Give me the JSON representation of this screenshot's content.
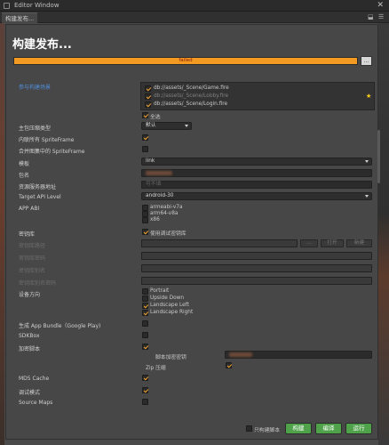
{
  "window": {
    "title": "Editor Window",
    "close": "✕"
  },
  "tab": {
    "label": "构建发布...",
    "ctl1": "⬓",
    "ctl2": "☰"
  },
  "header": {
    "title": "构建发布..."
  },
  "progress": {
    "status": "failed",
    "fraction": 1.0,
    "button": "…"
  },
  "scenes_section": {
    "label": "参与构建场景",
    "items": [
      {
        "path": "db://assets/_Scene/Game.fire",
        "checked": true,
        "disabled": false
      },
      {
        "path": "db://assets/_Scene/Lobby.fire",
        "checked": true,
        "disabled": true
      },
      {
        "path": "db://assets/_Scene/Login.fire",
        "checked": true,
        "disabled": false
      }
    ],
    "select_all": "全选"
  },
  "fields": {
    "main_compress": {
      "label": "主包压缩类型",
      "value": "默认"
    },
    "inline_spriteframe": {
      "label": "内联所有 SpriteFrame"
    },
    "merge_spriteframe": {
      "label": "合并图集中的 SpriteFrame"
    },
    "template": {
      "label": "模板",
      "value": "link"
    },
    "package_name": {
      "label": "包名"
    },
    "resource_server": {
      "label": "资源服务器地址",
      "placeholder": "可不填"
    },
    "target_api": {
      "label": "Target API Level",
      "value": "android-30"
    },
    "app_abi": {
      "label": "APP ABI",
      "options": [
        "armeabi-v7a",
        "arm64-v8a",
        "x86"
      ]
    },
    "keystore": {
      "label": "密钥库",
      "option": "使用调试密钥库"
    },
    "keystore_path": {
      "label": "密钥库路径",
      "btn_dots": "…",
      "btn_open": "打开",
      "btn_new": "新建"
    },
    "keystore_pwd": {
      "label": "密钥库密码"
    },
    "key_alias": {
      "label": "密钥库别名"
    },
    "key_pwd": {
      "label": "密钥库别名密码"
    },
    "orientation": {
      "label": "设备方向",
      "options": [
        "Portrait",
        "Upside Down",
        "Landscape Left",
        "Landscape Right"
      ]
    },
    "app_bundle": {
      "label": "生成 App Bundle（Google Play)"
    },
    "sdkbox": {
      "label": "SDKBox"
    },
    "encrypt": {
      "label": "加密脚本",
      "key_label": "脚本加密密钥",
      "zip_label": "Zip 压缩"
    },
    "md5": {
      "label": "MD5 Cache"
    },
    "debug": {
      "label": "调试模式"
    },
    "source_maps": {
      "label": "Source Maps"
    }
  },
  "footer": {
    "only_build_script": "只构建脚本",
    "build": "构建",
    "compile": "编译",
    "run": "运行"
  },
  "colors": {
    "accent": "#f29a22",
    "failed_text": "#8b1b0e",
    "green_button": "#4fa24a",
    "check": "#f2a32e",
    "section_blue": "#4f8fdc"
  }
}
